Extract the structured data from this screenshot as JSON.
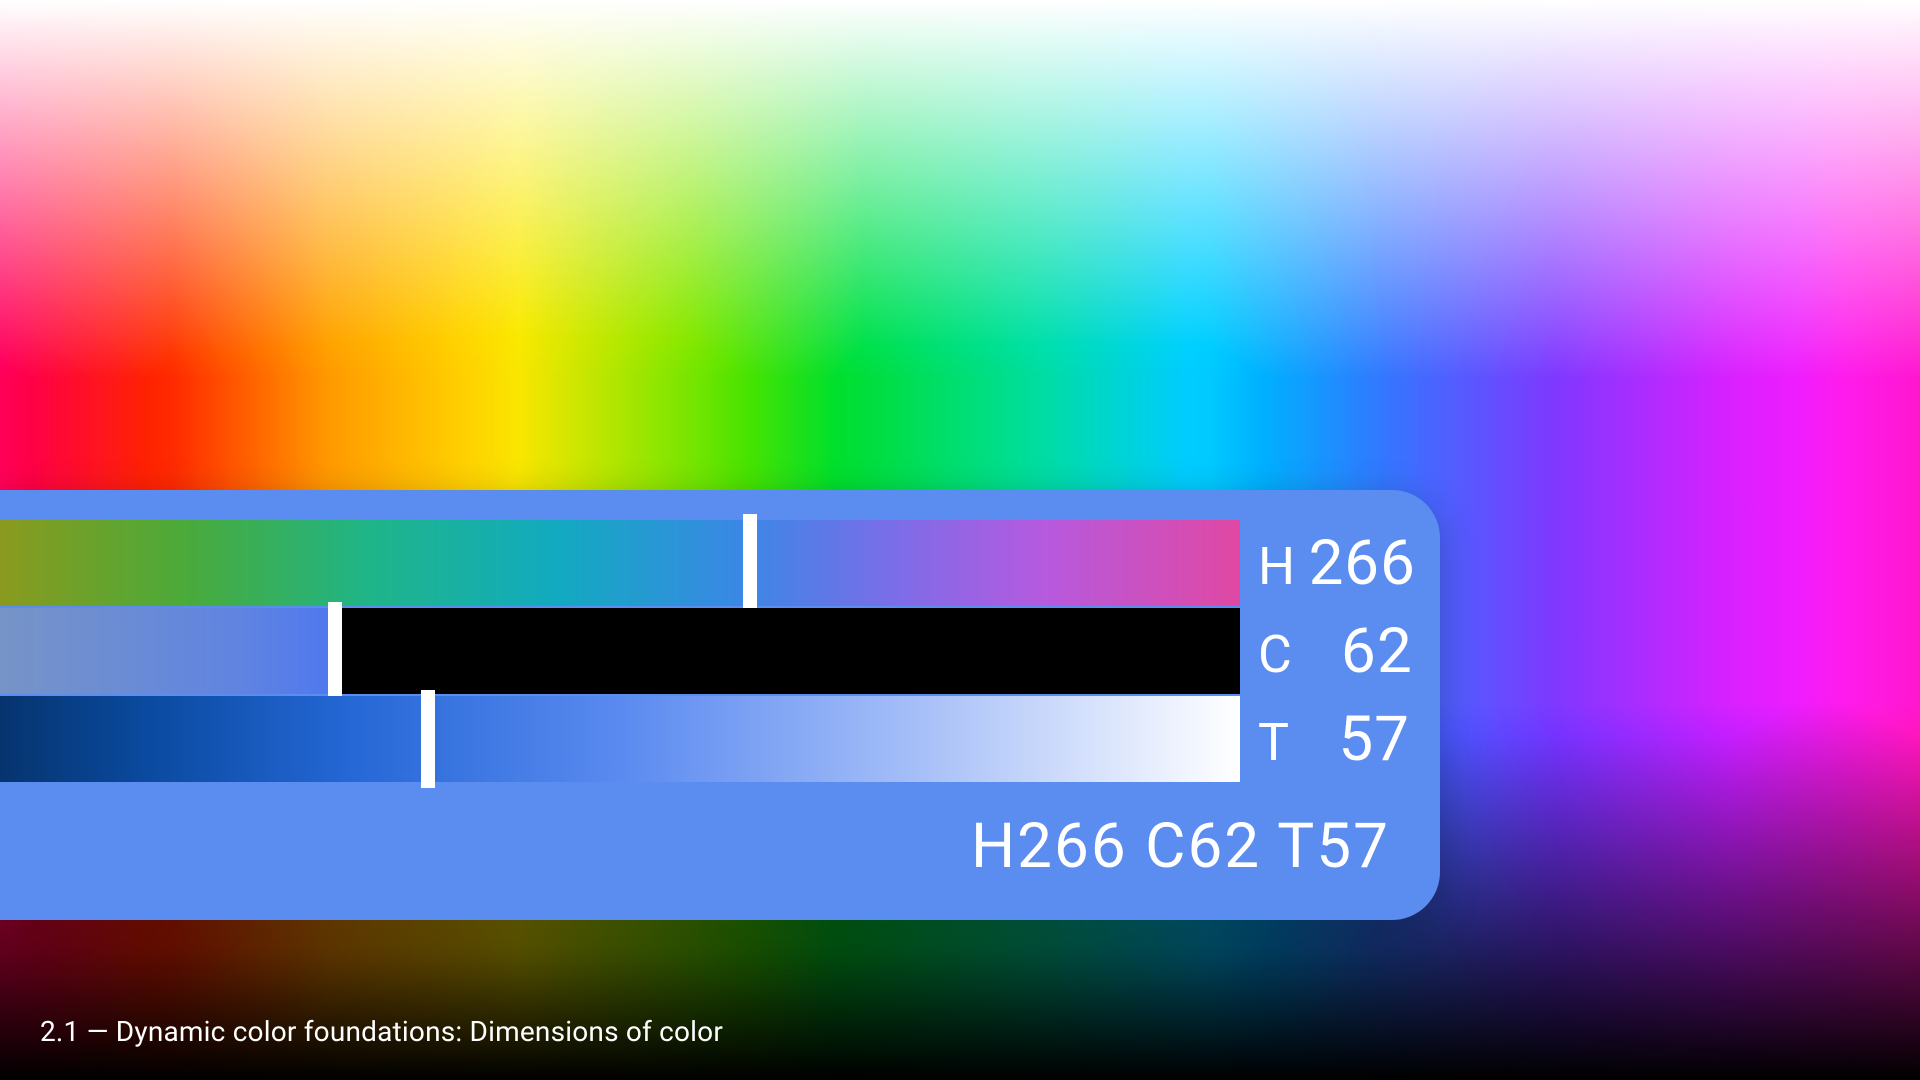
{
  "caption": "2.1 — Dynamic color foundations: Dimensions of color",
  "panel": {
    "background": "#5b8cf0",
    "sliders": {
      "hue": {
        "label": "H",
        "value": 266,
        "thumb_percent": 60.5
      },
      "chroma": {
        "label": "C",
        "value": 62,
        "thumb_percent": 27.0
      },
      "tone": {
        "label": "T",
        "value": 57,
        "thumb_percent": 34.5
      }
    },
    "summary": "H266  C62  T57"
  }
}
